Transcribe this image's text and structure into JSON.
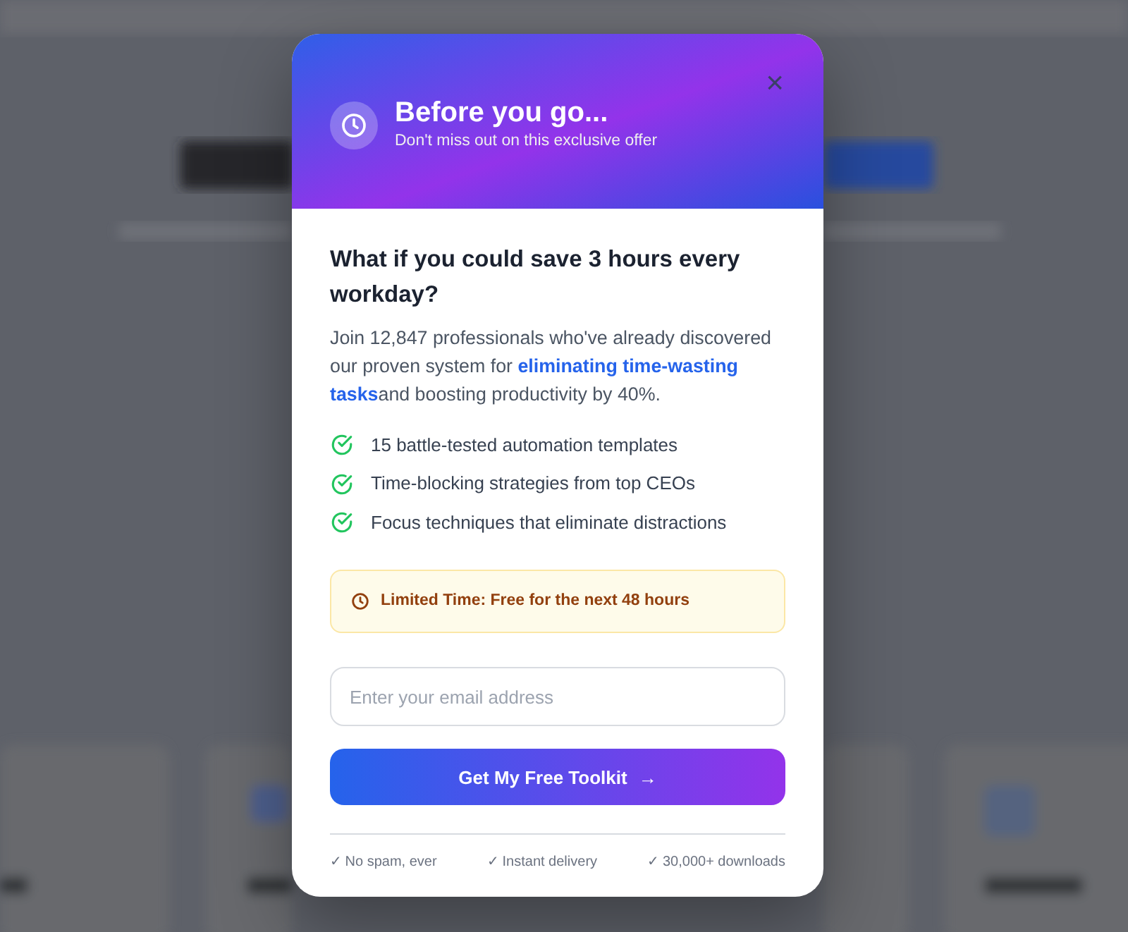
{
  "header": {
    "title": "Before you go...",
    "subtitle": "Don't miss out on this exclusive offer",
    "close": "×"
  },
  "headline": "What if you could save 3 hours every workday?",
  "intro": "Join 12,847 professionals who've already discovered our proven system for **eliminating time-wasting tasks**and boosting productivity by 40%.",
  "benefits": [
    "15 battle-tested automation templates",
    "Time-blocking strategies from top CEOs",
    "Focus techniques that eliminate distractions"
  ],
  "notice": "Limited Time: Free for the next 48 hours",
  "email": {
    "placeholder": "Enter your email address"
  },
  "cta": {
    "label": "Get My Free Toolkit",
    "arrow": "→"
  },
  "assurances": [
    "✓ No spam, ever",
    "✓ Instant delivery",
    "✓ 30,000+ downloads"
  ]
}
